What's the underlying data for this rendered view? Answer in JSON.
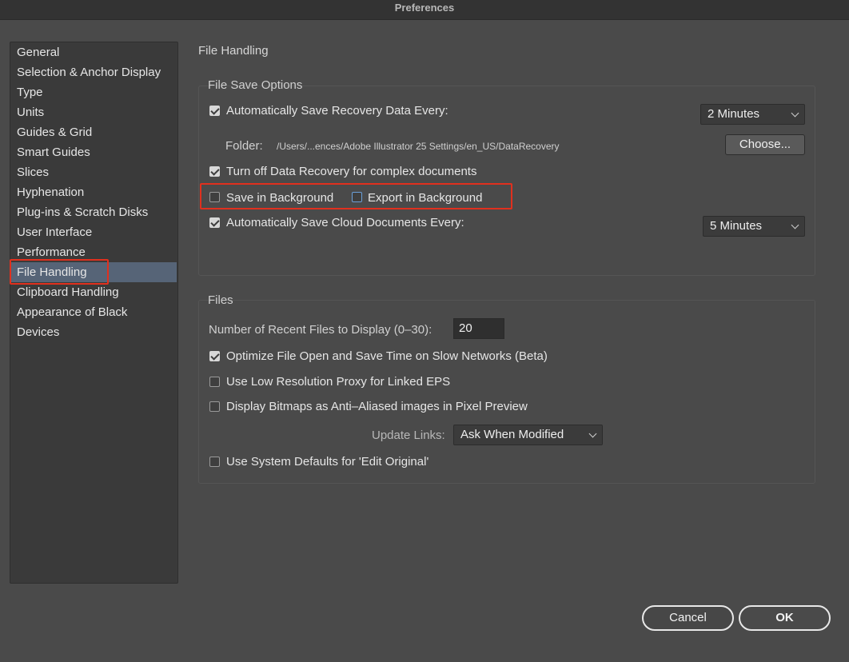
{
  "window": {
    "title": "Preferences"
  },
  "sidebar": {
    "items": [
      {
        "label": "General"
      },
      {
        "label": "Selection & Anchor Display"
      },
      {
        "label": "Type"
      },
      {
        "label": "Units"
      },
      {
        "label": "Guides & Grid"
      },
      {
        "label": "Smart Guides"
      },
      {
        "label": "Slices"
      },
      {
        "label": "Hyphenation"
      },
      {
        "label": "Plug-ins & Scratch Disks"
      },
      {
        "label": "User Interface"
      },
      {
        "label": "Performance"
      },
      {
        "label": "File Handling",
        "selected": true
      },
      {
        "label": "Clipboard Handling"
      },
      {
        "label": "Appearance of Black"
      },
      {
        "label": "Devices"
      }
    ]
  },
  "page": {
    "heading": "File Handling"
  },
  "file_save_options": {
    "title": "File Save Options",
    "auto_save_recovery": {
      "label": "Automatically Save Recovery Data Every:",
      "checked": true
    },
    "recovery_interval": {
      "value": "2 Minutes"
    },
    "folder": {
      "label": "Folder:",
      "path": "/Users/...ences/Adobe Illustrator 25 Settings/en_US/DataRecovery",
      "choose_label": "Choose..."
    },
    "turn_off_recovery": {
      "label": "Turn off Data Recovery for complex documents",
      "checked": true
    },
    "save_in_background": {
      "label": "Save in Background",
      "checked": false
    },
    "export_in_background": {
      "label": "Export in Background",
      "checked": false
    },
    "auto_save_cloud": {
      "label": "Automatically Save Cloud Documents Every:",
      "checked": true
    },
    "cloud_interval": {
      "value": "5 Minutes"
    }
  },
  "files": {
    "title": "Files",
    "recent_files": {
      "label": "Number of Recent Files to Display (0–30):",
      "value": "20"
    },
    "optimize_file_open": {
      "label": "Optimize File Open and Save Time on Slow Networks (Beta)",
      "checked": true
    },
    "low_res_proxy": {
      "label": "Use Low Resolution Proxy for Linked EPS",
      "checked": false
    },
    "anti_aliased": {
      "label": "Display Bitmaps as Anti–Aliased images in Pixel Preview",
      "checked": false
    },
    "update_links": {
      "label": "Update Links:",
      "value": "Ask When Modified"
    },
    "system_defaults": {
      "label": "Use System Defaults for 'Edit Original'",
      "checked": false
    }
  },
  "footer": {
    "cancel_label": "Cancel",
    "ok_label": "OK"
  },
  "colors": {
    "highlight": "#e0301e",
    "selection": "#566477"
  }
}
